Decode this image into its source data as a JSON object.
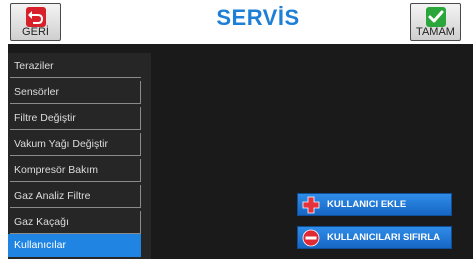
{
  "header": {
    "back_label": "GERİ",
    "title": "SERVİS",
    "ok_label": "TAMAM"
  },
  "menu": {
    "items": [
      {
        "label": "Teraziler"
      },
      {
        "label": "Sensörler"
      },
      {
        "label": "Filtre Değiştir"
      },
      {
        "label": "Vakum Yağı Değiştir"
      },
      {
        "label": "Kompresör Bakım"
      },
      {
        "label": "Gaz Analiz Filtre"
      },
      {
        "label": "Gaz Kaçağı"
      },
      {
        "label": "Kullanıcılar"
      }
    ],
    "active_index": 7
  },
  "actions": {
    "add_user_label": "KULLANICI EKLE",
    "reset_users_label": "KULLANICILARI SIFIRLA"
  },
  "icons": {
    "back": "back-arrow-icon",
    "ok": "checkmark-icon",
    "add": "plus-icon",
    "reset": "minus-icon"
  },
  "colors": {
    "accent": "#1f84e2",
    "title": "#1e7fd6",
    "panel_bg": "#1a1a1a",
    "back_icon": "#d8202a",
    "ok_icon": "#2aa63a"
  }
}
